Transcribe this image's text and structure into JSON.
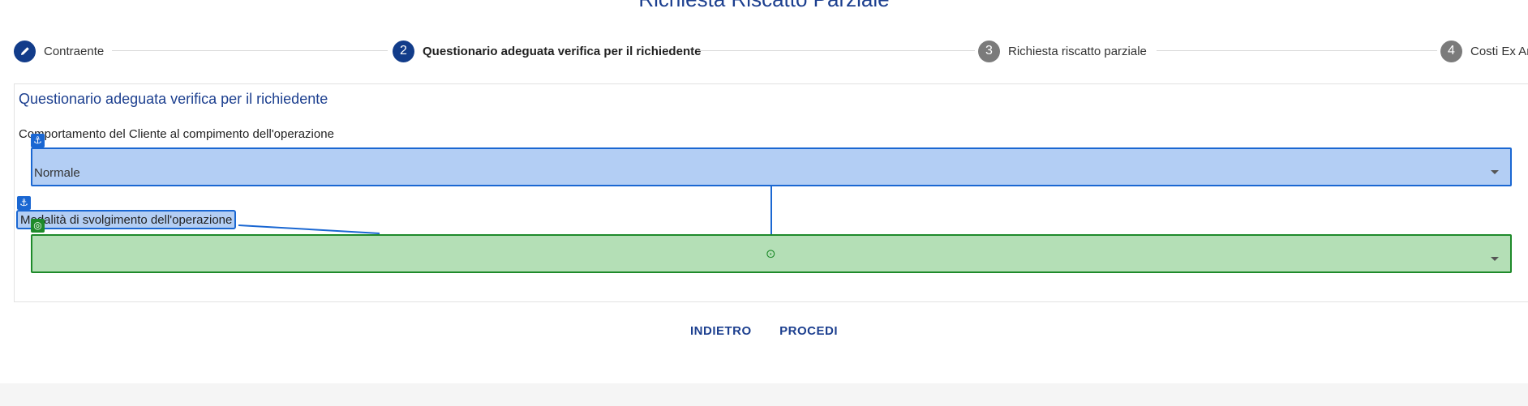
{
  "page": {
    "title": "Richiesta Riscatto Parziale"
  },
  "stepper": {
    "steps": [
      {
        "number": "",
        "label": "Contraente",
        "state": "completed",
        "icon": "pencil-icon"
      },
      {
        "number": "2",
        "label": "Questionario adeguata verifica per il richiedente",
        "state": "active"
      },
      {
        "number": "3",
        "label": "Richiesta riscatto parziale",
        "state": "inactive"
      },
      {
        "number": "4",
        "label": "Costi Ex Ar",
        "state": "inactive"
      }
    ]
  },
  "form": {
    "title": "Questionario adeguata verifica per il richiedente",
    "fields": [
      {
        "label": "Comportamento del Cliente al compimento dell'operazione",
        "value": "Normale"
      },
      {
        "label": "Modalità di svolgimento dell'operazione",
        "value": ""
      }
    ]
  },
  "overlay": {
    "anchor_glyph": "⚓",
    "target_glyph": "◎",
    "crosshair_glyph": "⊙"
  },
  "actions": {
    "back_label": "INDIETRO",
    "next_label": "PROCEDI"
  },
  "colors": {
    "primary": "#1c3f8f",
    "step_active": "#123c8a",
    "step_inactive": "#7b7b7b",
    "highlight_blue": "#b3cef4",
    "highlight_green": "#b4dfb6"
  }
}
